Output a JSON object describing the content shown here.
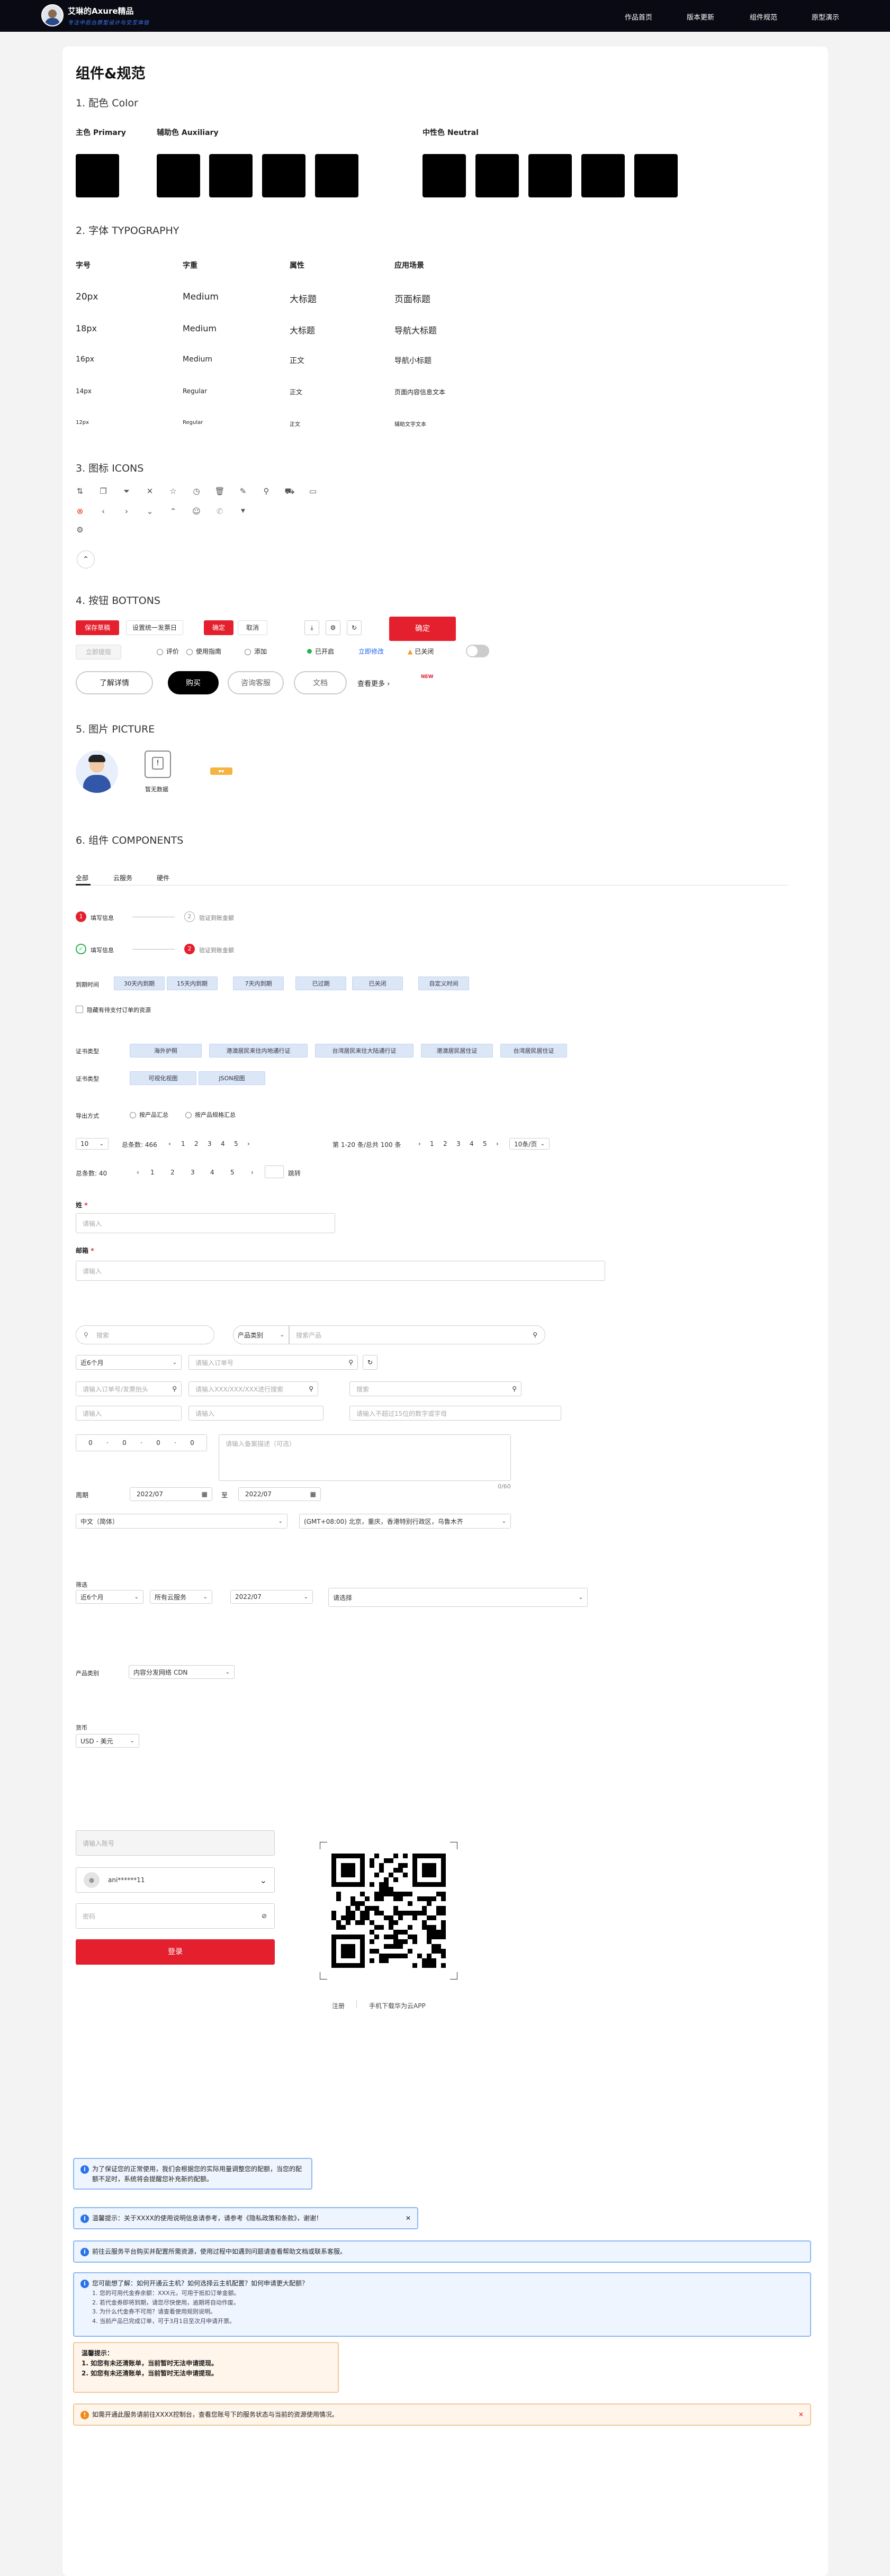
{
  "header": {
    "brand": "艾琳的Axure精品",
    "brand_sub": "专注中后台原型设计与交互体验",
    "nav": [
      "作品首页",
      "版本更新",
      "组件规范",
      "原型演示"
    ]
  },
  "page": {
    "title": "组件&规范"
  },
  "colors": {
    "title": "1. 配色 Color",
    "primary_label": "主色 Primary",
    "auxiliary_label": "辅助色 Auxiliary",
    "neutral_label": "中性色 Neutral",
    "swatch_hex": "#000000"
  },
  "typography": {
    "title": "2. 字体 TYPOGRAPHY",
    "headers": [
      "字号",
      "字重",
      "属性",
      "应用场景"
    ],
    "rows": [
      [
        "20px",
        "Medium",
        "大标题",
        "页面标题"
      ],
      [
        "18px",
        "Medium",
        "大标题",
        "导航大标题"
      ],
      [
        "16px",
        "Medium",
        "正文",
        "导航小标题"
      ],
      [
        "14px",
        "Regular",
        "正文",
        "页面内容信息文本"
      ],
      [
        "12px",
        "Regular",
        "正文",
        "辅助文字文本"
      ]
    ]
  },
  "icons": {
    "title": "3. 图标 ICONS"
  },
  "buttons": {
    "title": "4. 按钮 BOTTONS",
    "primary_small": "保存草稿",
    "one_key": "设置统一发票日",
    "confirm": "确定",
    "cancel": "取消",
    "big_confirm": "确定",
    "disabled": "立即提现",
    "eval": "评价",
    "usage": "使用指南",
    "add": "添加",
    "enabled": "已开启",
    "reset_link": "立即修改",
    "closed": "已关闭",
    "learn": "了解详情",
    "buy": "购买",
    "contact": "咨询客服",
    "doc": "文档",
    "more": "查看更多",
    "new_badge": "NEW"
  },
  "pictures": {
    "title": "5. 图片 PICTURE",
    "no_data": "暂无数据"
  },
  "components": {
    "title": "6. 组件 COMPONENTS",
    "tabs": [
      "全部",
      "云服务",
      "硬件"
    ],
    "steps1": [
      "填写信息",
      "验证到账金额"
    ],
    "steps2": [
      "填写信息",
      "验证到账金额"
    ],
    "expire_label": "到期时间",
    "expire_tags": [
      "30天内到期",
      "15天内到期",
      "7天内到期",
      "已过期",
      "已关闭",
      "自定义时间"
    ],
    "checkbox_label": "隐藏有待支付订单的资源",
    "cert_label": "证书类型",
    "cert_tags": [
      "海外护照",
      "港澳居民来往内地通行证",
      "台湾居民来往大陆通行证",
      "港澳居民居住证",
      "台湾居民居住证"
    ],
    "view_label": "证书类型",
    "view_tags": [
      "可视化视图",
      "JSON视图"
    ],
    "export_label": "导出方式",
    "export_opts": [
      "按产品汇总",
      "按产品规格汇总"
    ],
    "pager1": {
      "size": "10",
      "total": "总条数: 466",
      "pages": [
        "1",
        "2",
        "3",
        "4",
        "5"
      ]
    },
    "pager2": {
      "range": "第 1-20 条/总共 100 条",
      "pages": [
        "1",
        "2",
        "3",
        "4",
        "5"
      ],
      "per": "10条/页"
    },
    "pager3": {
      "total": "总条数: 40",
      "pages": [
        "1",
        "2",
        "3",
        "4",
        "5"
      ],
      "jump": "跳转"
    },
    "name_label": "姓",
    "name_ph": "请输入",
    "email_label": "邮箱",
    "email_ph": "请输入",
    "search1_ph": "搜索",
    "product_cat": "产品类别",
    "search2_ph": "搜索产品",
    "recent": "近6个月",
    "order_ph": "请输入订单号",
    "inv_ph": "请输入订单号/发票抬头",
    "coupon_ph": "请输入XXX/XXX/XXX进行搜索",
    "search3_ph": "搜索",
    "short_ph1": "请输入",
    "short_ph2": "请输入",
    "long_ph": "请输入不超过15位的数字或字母",
    "ip": [
      "0",
      "0",
      "0",
      "0"
    ],
    "textarea_ph": "请输入备案描述（可选）",
    "textarea_count": "0/60",
    "period_label": "周期",
    "date1": "2022/07",
    "date_to": "至",
    "date2": "2022/07",
    "lang": "中文（简体）",
    "tz": "(GMT+08:00) 北京，重庆，香港特别行政区，乌鲁木齐",
    "filter_label": "筛选",
    "filters": [
      "近6个月",
      "所有云服务",
      "2022/07"
    ],
    "filter_select": "请选择",
    "product_type_label": "产品类别",
    "product_type_val": "内容分发网络 CDN",
    "currency_label": "货币",
    "currency_val": "USD - 美元"
  },
  "login": {
    "account_ph": "请输入账号",
    "user": "ani******11",
    "pwd_ph": "密码",
    "login_btn": "登录",
    "register": "注册",
    "scan": "手机下载华为云APP"
  },
  "alerts": [
    "为了保证您的正常使用，我们会根据您的实际用量调整您的配额，当您的配额不足时，系统将会提醒您补充新的配额。",
    "温馨提示：关于XXXX的使用说明信息请参考，请参考《隐私政策和条款》，谢谢！",
    "前往云服务平台购买并配置所需资源，使用过程中如遇到问题请查看帮助文档或联系客服。",
    "您可能想了解：如何开通云主机？如何选择云主机配置？如何申请更大配额？",
    "温馨提示：",
    "1. 如您有未还清账单，当前暂时无法申请提现。",
    "2. 如您有未还清账单，当前暂时无法申请提现。",
    "如需开通此服务请前往XXXX控制台，查看您账号下的服务状态与当前的资源使用情况。"
  ],
  "alert_list": [
    "1. 您的可用代金券余额：XXX元，可用于抵扣订单金额。",
    "2. 若代金券即将到期，请您尽快使用，逾期将自动作废。",
    "3. 为什么代金券不可用？请查看使用规则说明。",
    "4. 当前产品已完成订单，可于3月1日至次月申请开票。"
  ]
}
